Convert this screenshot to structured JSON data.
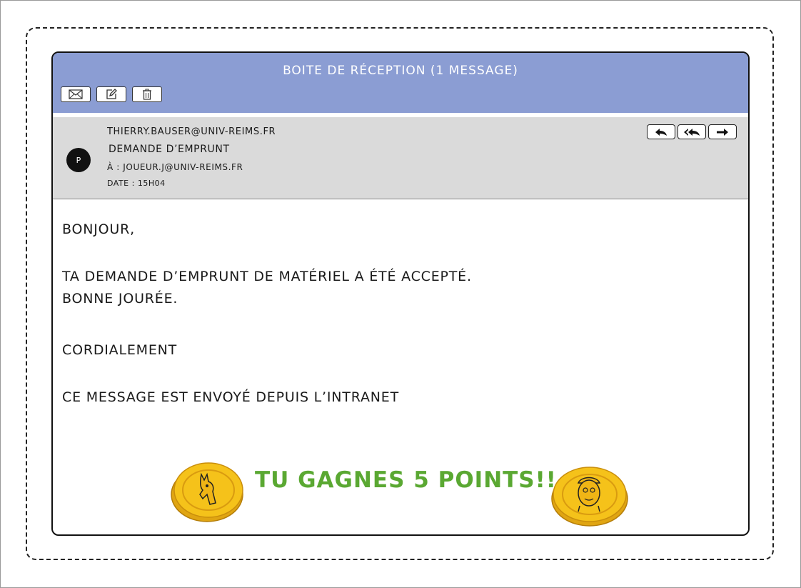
{
  "window": {
    "title": "Boite de réception  (1 message)"
  },
  "toolbar": {
    "icons": [
      "envelope-icon",
      "edit-icon",
      "trash-icon"
    ]
  },
  "message": {
    "avatar_initial": "P",
    "from": "thierry.bauser@univ-reims.fr",
    "subject": "Demande d’emprunt",
    "to": "à : joueur.j@univ-reims.fr",
    "date": "Date : 15h04",
    "actions": [
      "reply-icon",
      "reply-all-icon",
      "forward-icon"
    ]
  },
  "body": {
    "greeting": "Bonjour,",
    "line1": "Ta demande d’emprunt de matériel a été accepté.",
    "line2": "Bonne jourée.",
    "closing": "Cordialement",
    "footer": "Ce message est envoyé depuis l’intranet"
  },
  "reward": {
    "text": "Tu gagnes 5 points!!",
    "color": "#5aa832",
    "coin_color": "#f5c21a"
  },
  "colors": {
    "header": "#8b9dd3",
    "meta_background": "#dadada"
  }
}
